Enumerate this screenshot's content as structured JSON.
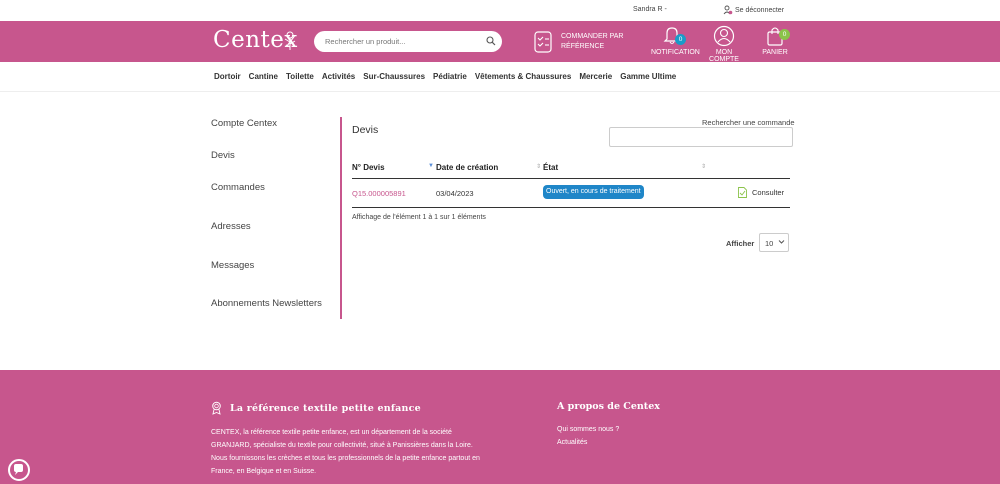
{
  "topbar": {
    "user": "Sandra R -",
    "logout": "Se déconnecter"
  },
  "header": {
    "logo": "Centex",
    "search_placeholder": "Rechercher un produit...",
    "order_by_ref_line1": "Commander par",
    "order_by_ref_line2": "référence",
    "notification_label": "Notification",
    "notification_count": "0",
    "account_label": "Mon compte",
    "cart_label": "Panier",
    "cart_count": "0"
  },
  "nav": {
    "items": [
      "Dortoir",
      "Cantine",
      "Toilette",
      "Activités",
      "Sur-Chaussures",
      "Pédiatrie",
      "Vêtements & Chaussures",
      "Mercerie",
      "Gamme Ultime"
    ]
  },
  "sidebar": {
    "items": [
      "Compte Centex",
      "Devis",
      "Commandes",
      "Adresses",
      "Messages",
      "Abonnements Newsletters"
    ]
  },
  "main": {
    "title": "Devis",
    "search_label": "Rechercher une commande",
    "columns": [
      "N° Devis",
      "Date de création",
      "État"
    ],
    "rows": [
      {
        "number": "Q15.000005891",
        "date": "03/04/2023",
        "status": "Ouvert, en cours de traitement",
        "action": "Consulter"
      }
    ],
    "info": "Affichage de l'élément 1 à 1 sur 1 éléments",
    "show_label": "Afficher",
    "per_page": "10"
  },
  "footer": {
    "title1": "La référence textile petite enfance",
    "text": "CENTEX, la référence textile petite enfance, est un département de la société GRANJARD, spécialiste du textile pour collectivité, situé à Panissières dans la Loire. Nous fournissons les crèches et tous les professionnels de la petite enfance partout en France, en Belgique et en Suisse.",
    "title2": "A propos de Centex",
    "links": [
      "Qui sommes nous ?",
      "Actualités"
    ]
  },
  "colors": {
    "brand": "#c7568d",
    "status_blue": "#1f86c8",
    "badge_teal": "#1a9bc8",
    "badge_green": "#8bc34a"
  }
}
